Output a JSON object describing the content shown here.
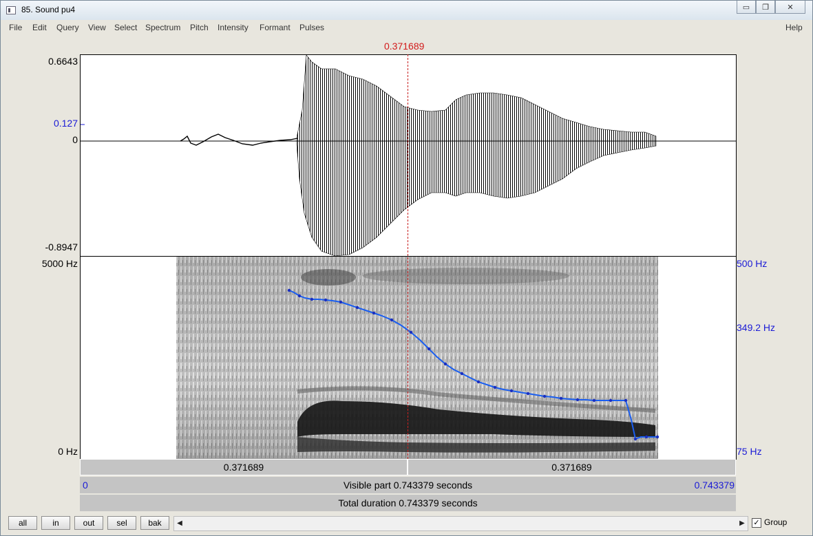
{
  "window": {
    "title": "85. Sound pu4"
  },
  "menu": [
    "File",
    "Edit",
    "Query",
    "View",
    "Select",
    "Spectrum",
    "Pitch",
    "Intensity",
    "Formant",
    "Pulses"
  ],
  "help": "Help",
  "cursor": {
    "time_label": "0.371689"
  },
  "waveform": {
    "max_label": "0.6643",
    "value_label": "0.127",
    "zero_label": "0",
    "min_label": "-0.8947"
  },
  "spectrogram": {
    "freq_top": "5000 Hz",
    "freq_bottom": "0 Hz"
  },
  "pitch": {
    "top": "500 Hz",
    "mid": "349.2 Hz",
    "bottom": "75 Hz"
  },
  "bars": {
    "left_part": "0.371689",
    "right_part": "0.371689",
    "visible_start": "0",
    "visible_text": "Visible part 0.743379 seconds",
    "visible_end": "0.743379",
    "total_text": "Total duration 0.743379 seconds"
  },
  "buttons": {
    "all": "all",
    "in": "in",
    "out": "out",
    "sel": "sel",
    "bak": "bak"
  },
  "group": {
    "label": "Group",
    "checked": "✓"
  },
  "colors": {
    "cursor": "#c81e1e",
    "pitch_line": "#1a5ef0",
    "axis_blue": "#1a1ad6"
  }
}
